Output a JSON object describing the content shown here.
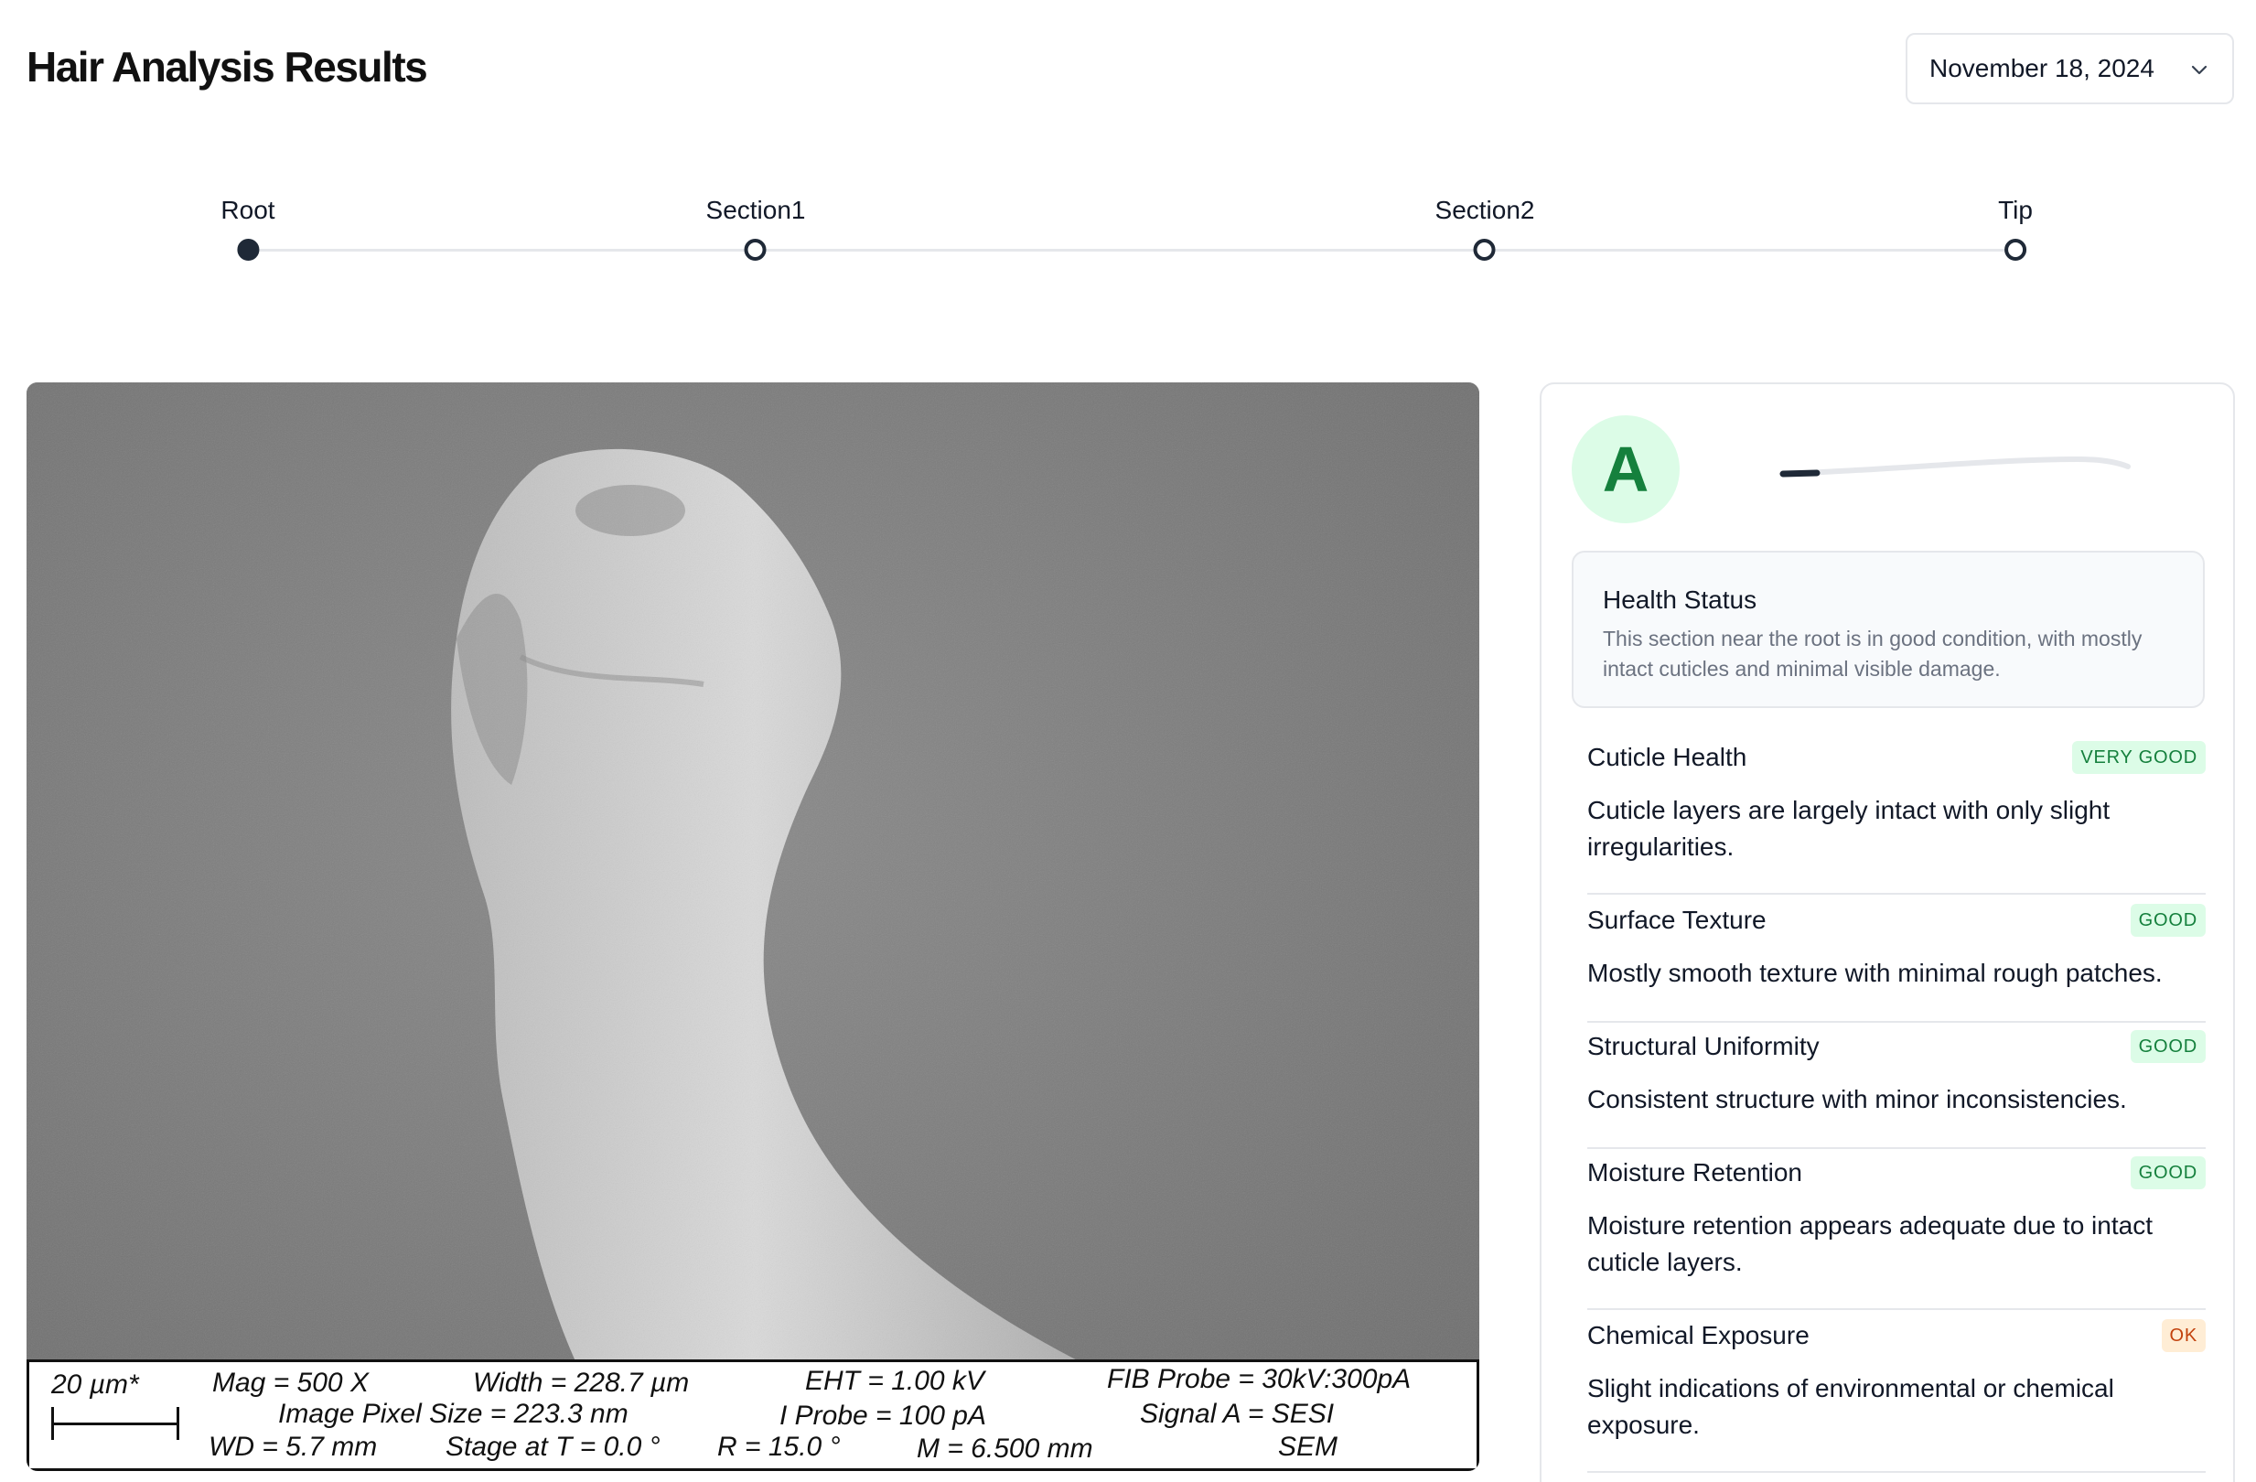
{
  "header": {
    "title": "Hair Analysis Results"
  },
  "date_select": {
    "value": "November 18, 2024"
  },
  "timeline": {
    "stops": [
      {
        "label": "Root",
        "active": true
      },
      {
        "label": "Section1",
        "active": false
      },
      {
        "label": "Section2",
        "active": false
      },
      {
        "label": "Tip",
        "active": false
      }
    ]
  },
  "sem": {
    "scale": "20 µm*",
    "mag": "Mag =    500 X",
    "width": "Width = 228.7 µm",
    "pixel_size": "Image Pixel Size = 223.3 nm",
    "wd": "WD =   5.7 mm",
    "stage": "Stage at T =    0.0 °",
    "eht": "EHT =   1.00 kV",
    "iprobe": "I Probe =     100 pA",
    "r": "R =   15.0 °",
    "m": "M = 6.500 mm",
    "fib": "FIB Probe = 30kV:300pA",
    "signal": "Signal A = SESI",
    "sem_label": "SEM"
  },
  "summary": {
    "grade": "A",
    "accent": "#15803d",
    "health_title": "Health Status",
    "health_desc": "This section near the root is in good condition, with mostly intact cuticles and minimal visible damage."
  },
  "metrics": [
    {
      "name": "Cuticle Health",
      "badge": "VERY GOOD",
      "tone": "green",
      "desc": "Cuticle layers are largely intact with only slight irregularities."
    },
    {
      "name": "Surface Texture",
      "badge": "GOOD",
      "tone": "green",
      "desc": "Mostly smooth texture with minimal rough patches."
    },
    {
      "name": "Structural Uniformity",
      "badge": "GOOD",
      "tone": "green",
      "desc": "Consistent structure with minor inconsistencies."
    },
    {
      "name": "Moisture Retention",
      "badge": "GOOD",
      "tone": "green",
      "desc": "Moisture retention appears adequate due to intact cuticle layers."
    },
    {
      "name": "Chemical Exposure",
      "badge": "OK",
      "tone": "orange",
      "desc": "Slight indications of environmental or chemical exposure."
    }
  ]
}
